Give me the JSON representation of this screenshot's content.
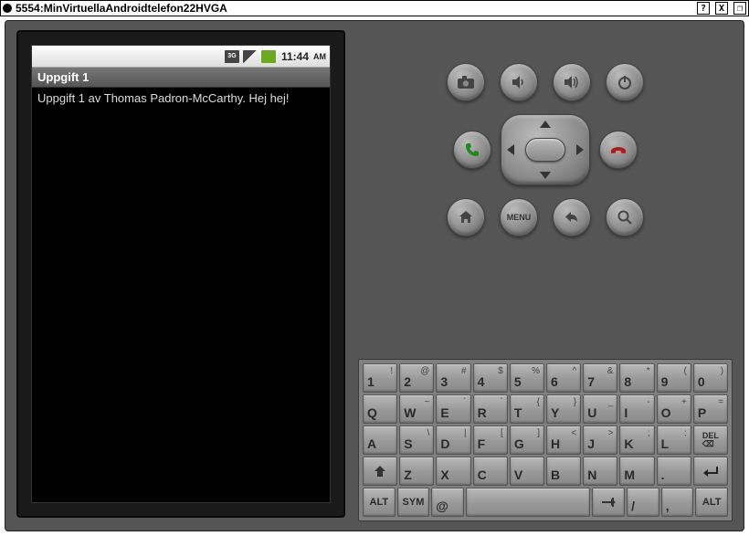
{
  "window": {
    "title": "5554:MinVirtuellaAndroidtelefon22HVGA",
    "btn_help": "?",
    "btn_close": "X",
    "btn_restore": "❐"
  },
  "phone": {
    "status": {
      "net": "3G",
      "clock": "11:44",
      "ampm": "AM"
    },
    "app_title": "Uppgift 1",
    "app_body": "Uppgift 1 av Thomas Padron-McCarthy. Hej hej!"
  },
  "buttons": {
    "menu_label": "MENU",
    "del_label": "DEL",
    "alt_label": "ALT",
    "sym_label": "SYM"
  },
  "keyboard": {
    "row1": [
      {
        "m": "1",
        "a": "!"
      },
      {
        "m": "2",
        "a": "@"
      },
      {
        "m": "3",
        "a": "#"
      },
      {
        "m": "4",
        "a": "$"
      },
      {
        "m": "5",
        "a": "%"
      },
      {
        "m": "6",
        "a": "^"
      },
      {
        "m": "7",
        "a": "&"
      },
      {
        "m": "8",
        "a": "*"
      },
      {
        "m": "9",
        "a": "("
      },
      {
        "m": "0",
        "a": ")"
      }
    ],
    "row2": [
      {
        "m": "Q",
        "a": ""
      },
      {
        "m": "W",
        "a": "~"
      },
      {
        "m": "E",
        "a": "´"
      },
      {
        "m": "R",
        "a": "`"
      },
      {
        "m": "T",
        "a": "{"
      },
      {
        "m": "Y",
        "a": "}"
      },
      {
        "m": "U",
        "a": "_"
      },
      {
        "m": "I",
        "a": "-"
      },
      {
        "m": "O",
        "a": "+"
      },
      {
        "m": "P",
        "a": "="
      }
    ],
    "row3": [
      {
        "m": "A",
        "a": ""
      },
      {
        "m": "S",
        "a": "\\"
      },
      {
        "m": "D",
        "a": "|"
      },
      {
        "m": "F",
        "a": "["
      },
      {
        "m": "G",
        "a": "]"
      },
      {
        "m": "H",
        "a": "<"
      },
      {
        "m": "J",
        "a": ">"
      },
      {
        "m": "K",
        "a": ";"
      },
      {
        "m": "L",
        "a": ":"
      }
    ],
    "row4": [
      {
        "m": "Z",
        "a": ""
      },
      {
        "m": "X",
        "a": ""
      },
      {
        "m": "C",
        "a": ""
      },
      {
        "m": "V",
        "a": ""
      },
      {
        "m": "B",
        "a": ""
      },
      {
        "m": "N",
        "a": ""
      },
      {
        "m": "M",
        "a": ""
      },
      {
        "m": ".",
        "a": ""
      }
    ],
    "row5": {
      "at": "@",
      "slash": "/",
      "comma": ","
    }
  }
}
